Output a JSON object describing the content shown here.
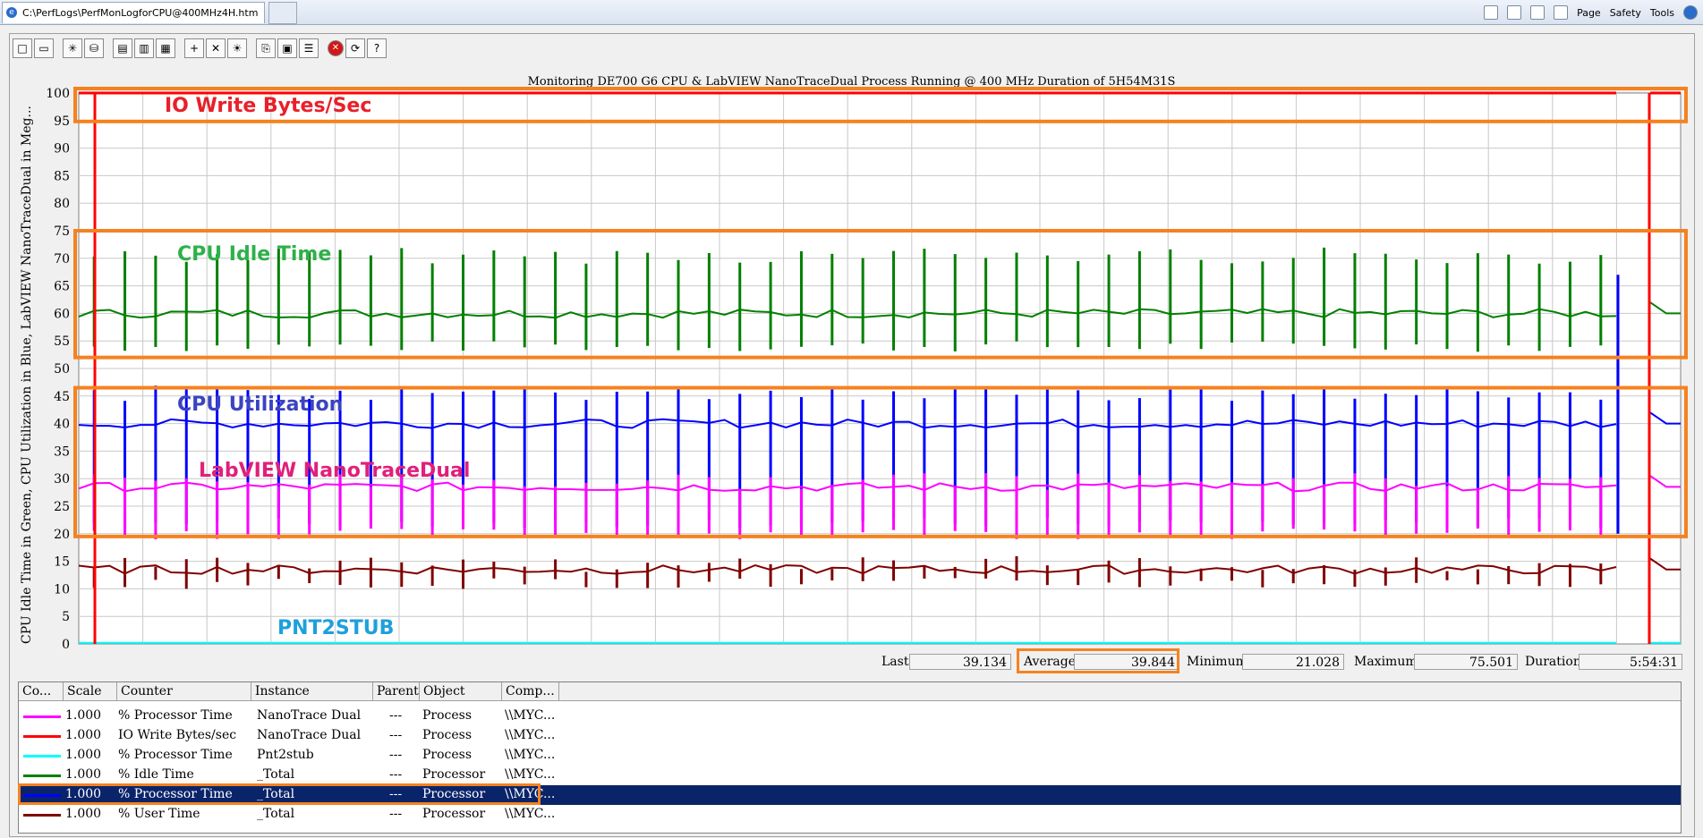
{
  "browser": {
    "tab_title": "C:\\PerfLogs\\PerfMonLogforCPU@400MHz4H.htm",
    "commands": [
      "Page",
      "Safety",
      "Tools"
    ]
  },
  "graph": {
    "title": "Monitoring DE700 G6 CPU & LabVIEW NanoTraceDual Process Running @ 400 MHz Duration of 5H54M31S",
    "ylabel": "CPU Idle Time in Green, CPU Utilization in Blue, LabVIEW NanoTraceDual in Meg...",
    "y_ticks": [
      "0",
      "5",
      "10",
      "15",
      "20",
      "25",
      "30",
      "35",
      "40",
      "45",
      "50",
      "55",
      "60",
      "65",
      "70",
      "75",
      "80",
      "85",
      "90",
      "95",
      "100"
    ]
  },
  "chart_data": {
    "type": "line",
    "ylim": [
      0,
      100
    ],
    "grid": true,
    "series": [
      {
        "name": "% Processor Time (NanoTrace Dual)",
        "color": "#ff00ff",
        "level": 28.5,
        "spike_low": 19,
        "spike_high": 31
      },
      {
        "name": "IO Write Bytes/sec",
        "color": "#ff0000",
        "level": 100
      },
      {
        "name": "% Processor Time (Pnt2stub)",
        "color": "#00ffff",
        "level": 0.2
      },
      {
        "name": "% Idle Time (_Total)",
        "color": "#008000",
        "level": 60,
        "spike_low": 53,
        "spike_high": 72
      },
      {
        "name": "% Processor Time (_Total)",
        "color": "#0000ff",
        "level": 40,
        "spike_low": 21,
        "spike_high": 47
      },
      {
        "name": "% User Time (_Total)",
        "color": "#800000",
        "level": 13.5,
        "spike_low": 10,
        "spike_high": 16
      }
    ]
  },
  "annotations": {
    "io": "IO Write Bytes/Sec",
    "idle": "CPU Idle Time",
    "util": "CPU Utilization",
    "labview": "LabVIEW NanoTraceDual",
    "pnt2stub": "PNT2STUB"
  },
  "values": {
    "last_label": "Last",
    "last": "39.134",
    "average_label": "Average",
    "average": "39.844",
    "minimum_label": "Minimum",
    "minimum": "21.028",
    "maximum_label": "Maximum",
    "maximum": "75.501",
    "duration_label": "Duration",
    "duration": "5:54:31"
  },
  "legend": {
    "headers": [
      "Co...",
      "Scale",
      "Counter",
      "Instance",
      "Parent",
      "Object",
      "Comp..."
    ],
    "rows": [
      {
        "color": "#ff00ff",
        "scale": "1.000",
        "counter": "% Processor Time",
        "instance": "NanoTrace Dual",
        "parent": "---",
        "object": "Process",
        "computer": "\\\\MYC..."
      },
      {
        "color": "#ff0000",
        "scale": "1.000",
        "counter": "IO Write Bytes/sec",
        "instance": "NanoTrace Dual",
        "parent": "---",
        "object": "Process",
        "computer": "\\\\MYC..."
      },
      {
        "color": "#00ffff",
        "scale": "1.000",
        "counter": "% Processor Time",
        "instance": "Pnt2stub",
        "parent": "---",
        "object": "Process",
        "computer": "\\\\MYC..."
      },
      {
        "color": "#008000",
        "scale": "1.000",
        "counter": "% Idle Time",
        "instance": "_Total",
        "parent": "---",
        "object": "Processor",
        "computer": "\\\\MYC..."
      },
      {
        "color": "#0000ff",
        "scale": "1.000",
        "counter": "% Processor Time",
        "instance": "_Total",
        "parent": "---",
        "object": "Processor",
        "computer": "\\\\MYC...",
        "selected": true
      },
      {
        "color": "#800000",
        "scale": "1.000",
        "counter": "% User Time",
        "instance": "_Total",
        "parent": "---",
        "object": "Processor",
        "computer": "\\\\MYC..."
      }
    ]
  },
  "colors": {
    "highlight": "#f58220",
    "selection": "#0a246a"
  }
}
